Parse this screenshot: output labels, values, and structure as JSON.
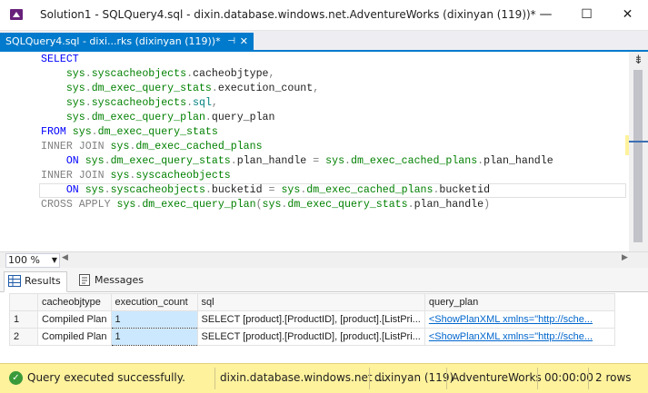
{
  "window": {
    "title": "Solution1 - SQLQuery4.sql - dixin.database.windows.net.AdventureWorks (dixinyan (119))*",
    "minimize_glyph": "—",
    "maximize_glyph": "☐",
    "close_glyph": "✕"
  },
  "document_tab": {
    "label": "SQLQuery4.sql - dixi...rks (dixinyan (119))*",
    "pin_glyph": "⊣",
    "close_glyph": "✕"
  },
  "editor": {
    "split_glyph": "⇟",
    "lines": [
      [
        {
          "t": "SELECT",
          "c": "kw"
        }
      ],
      [
        {
          "t": "    ",
          "c": "tx"
        },
        {
          "t": "sys",
          "c": "gn"
        },
        {
          "t": ".",
          "c": "gr"
        },
        {
          "t": "syscacheobjects",
          "c": "gn"
        },
        {
          "t": ".",
          "c": "gr"
        },
        {
          "t": "cacheobjtype",
          "c": "tx"
        },
        {
          "t": ",",
          "c": "gr"
        }
      ],
      [
        {
          "t": "    ",
          "c": "tx"
        },
        {
          "t": "sys",
          "c": "gn"
        },
        {
          "t": ".",
          "c": "gr"
        },
        {
          "t": "dm_exec_query_stats",
          "c": "gn"
        },
        {
          "t": ".",
          "c": "gr"
        },
        {
          "t": "execution_count",
          "c": "tx"
        },
        {
          "t": ",",
          "c": "gr"
        }
      ],
      [
        {
          "t": "    ",
          "c": "tx"
        },
        {
          "t": "sys",
          "c": "gn"
        },
        {
          "t": ".",
          "c": "gr"
        },
        {
          "t": "syscacheobjects",
          "c": "gn"
        },
        {
          "t": ".",
          "c": "gr"
        },
        {
          "t": "sql",
          "c": "tl"
        },
        {
          "t": ",",
          "c": "gr"
        }
      ],
      [
        {
          "t": "    ",
          "c": "tx"
        },
        {
          "t": "sys",
          "c": "gn"
        },
        {
          "t": ".",
          "c": "gr"
        },
        {
          "t": "dm_exec_query_plan",
          "c": "gn"
        },
        {
          "t": ".",
          "c": "gr"
        },
        {
          "t": "query_plan",
          "c": "tx"
        }
      ],
      [
        {
          "t": "FROM ",
          "c": "kw"
        },
        {
          "t": "sys",
          "c": "gn"
        },
        {
          "t": ".",
          "c": "gr"
        },
        {
          "t": "dm_exec_query_stats",
          "c": "gn"
        }
      ],
      [
        {
          "t": "INNER JOIN ",
          "c": "gr"
        },
        {
          "t": "sys",
          "c": "gn"
        },
        {
          "t": ".",
          "c": "gr"
        },
        {
          "t": "dm_exec_cached_plans",
          "c": "gn"
        }
      ],
      [
        {
          "t": "    ",
          "c": "tx"
        },
        {
          "t": "ON ",
          "c": "kw"
        },
        {
          "t": "sys",
          "c": "gn"
        },
        {
          "t": ".",
          "c": "gr"
        },
        {
          "t": "dm_exec_query_stats",
          "c": "gn"
        },
        {
          "t": ".",
          "c": "gr"
        },
        {
          "t": "plan_handle ",
          "c": "tx"
        },
        {
          "t": "= ",
          "c": "gr"
        },
        {
          "t": "sys",
          "c": "gn"
        },
        {
          "t": ".",
          "c": "gr"
        },
        {
          "t": "dm_exec_cached_plans",
          "c": "gn"
        },
        {
          "t": ".",
          "c": "gr"
        },
        {
          "t": "plan_handle",
          "c": "tx"
        }
      ],
      [
        {
          "t": "INNER JOIN ",
          "c": "gr"
        },
        {
          "t": "sys",
          "c": "gn"
        },
        {
          "t": ".",
          "c": "gr"
        },
        {
          "t": "syscacheobjects",
          "c": "gn"
        }
      ],
      [
        {
          "t": "    ",
          "c": "tx"
        },
        {
          "t": "ON ",
          "c": "kw"
        },
        {
          "t": "sys",
          "c": "gn"
        },
        {
          "t": ".",
          "c": "gr"
        },
        {
          "t": "syscacheobjects",
          "c": "gn"
        },
        {
          "t": ".",
          "c": "gr"
        },
        {
          "t": "bucketid ",
          "c": "tx"
        },
        {
          "t": "= ",
          "c": "gr"
        },
        {
          "t": "sys",
          "c": "gn"
        },
        {
          "t": ".",
          "c": "gr"
        },
        {
          "t": "dm_exec_cached_plans",
          "c": "gn"
        },
        {
          "t": ".",
          "c": "gr"
        },
        {
          "t": "bucketid",
          "c": "tx"
        }
      ],
      [
        {
          "t": "CROSS APPLY ",
          "c": "gr"
        },
        {
          "t": "sys",
          "c": "gn"
        },
        {
          "t": ".",
          "c": "gr"
        },
        {
          "t": "dm_exec_query_plan",
          "c": "gn"
        },
        {
          "t": "(",
          "c": "gr"
        },
        {
          "t": "sys",
          "c": "gn"
        },
        {
          "t": ".",
          "c": "gr"
        },
        {
          "t": "dm_exec_query_stats",
          "c": "gn"
        },
        {
          "t": ".",
          "c": "gr"
        },
        {
          "t": "plan_handle",
          "c": "tx"
        },
        {
          "t": ")",
          "c": "gr"
        }
      ]
    ],
    "current_line": 9
  },
  "zoom": {
    "value": "100 %"
  },
  "results": {
    "tabs": [
      "Results",
      "Messages"
    ],
    "columns": [
      "",
      "cacheobjtype",
      "execution_count",
      "sql",
      "query_plan"
    ],
    "rows": [
      [
        "1",
        "Compiled Plan",
        "1",
        "SELECT [product].[ProductID], [product].[ListPri...",
        "<ShowPlanXML xmlns=\"http://sche..."
      ],
      [
        "2",
        "Compiled Plan",
        "1",
        "SELECT [product].[ProductID], [product].[ListPri...",
        "<ShowPlanXML xmlns=\"http://sche..."
      ]
    ]
  },
  "status": {
    "message": "Query executed successfully.",
    "server": "dixin.database.windows.net ...",
    "user": "dixinyan (119)",
    "database": "AdventureWorks",
    "elapsed": "00:00:00",
    "rows": "2 rows"
  },
  "colors": {
    "accent": "#007acc",
    "status_bar": "#fff29d",
    "keyword": "#0000ff",
    "system_object": "#008000"
  }
}
